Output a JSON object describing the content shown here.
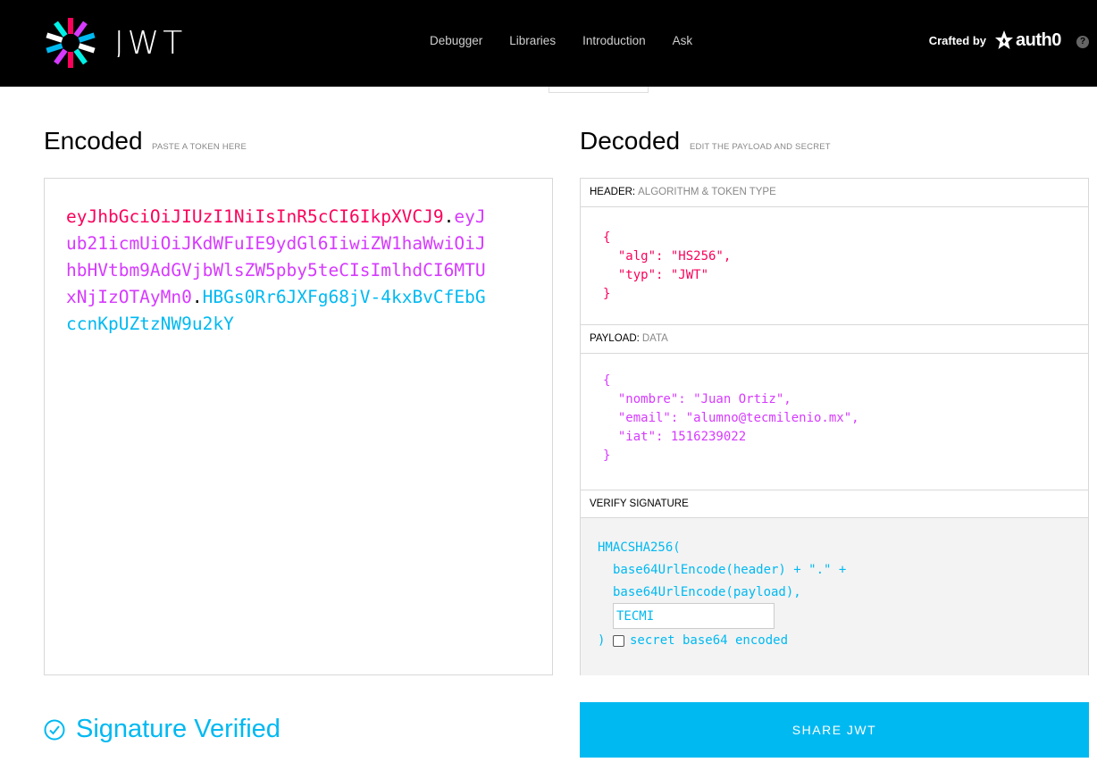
{
  "nav": {
    "logo_text": "JWT",
    "items": [
      "Debugger",
      "Libraries",
      "Introduction",
      "Ask"
    ],
    "crafted_by": "Crafted by",
    "auth0_text": "auth0",
    "help": "?"
  },
  "encoded": {
    "title": "Encoded",
    "subtitle": "PASTE A TOKEN HERE",
    "header_part": "eyJhbGciOiJIUzI1NiIsInR5cCI6IkpXVCJ9",
    "payload_part": "eyJub21icmUiOiJKdWFuIE9ydGl6IiwiZW1haWwiOiJhbHVtbm9AdGVjbWlsZW5pby5teCIsImlhdCI6MTUxNjIzOTAyMn0",
    "signature_part": "HBGs0Rr6JXFg68jV-4kxBvCfEbGccnKpUZtzNW9u2kY",
    "dot": "."
  },
  "decoded": {
    "title": "Decoded",
    "subtitle": "EDIT THE PAYLOAD AND SECRET",
    "header_label": "HEADER:",
    "header_sub": "ALGORITHM & TOKEN TYPE",
    "header_json": "{\n  \"alg\": \"HS256\",\n  \"typ\": \"JWT\"\n}",
    "payload_label": "PAYLOAD:",
    "payload_sub": "DATA",
    "payload_json": "{\n  \"nombre\": \"Juan Ortiz\",\n  \"email\": \"alumno@tecmilenio.mx\",\n  \"iat\": 1516239022\n}",
    "verify_label": "VERIFY SIGNATURE",
    "verify_line1": "HMACSHA256(",
    "verify_line2": "base64UrlEncode(header) + \".\" +",
    "verify_line3": "base64UrlEncode(payload),",
    "secret_value": "TECMI",
    "verify_close": ")",
    "secret_checkbox_label": "secret base64 encoded",
    "secret_checked": false
  },
  "status": {
    "verified_text": "Signature Verified"
  },
  "share_button": "SHARE JWT",
  "colors": {
    "header": "#fb015b",
    "payload": "#d63aff",
    "signature": "#00b9f1"
  }
}
